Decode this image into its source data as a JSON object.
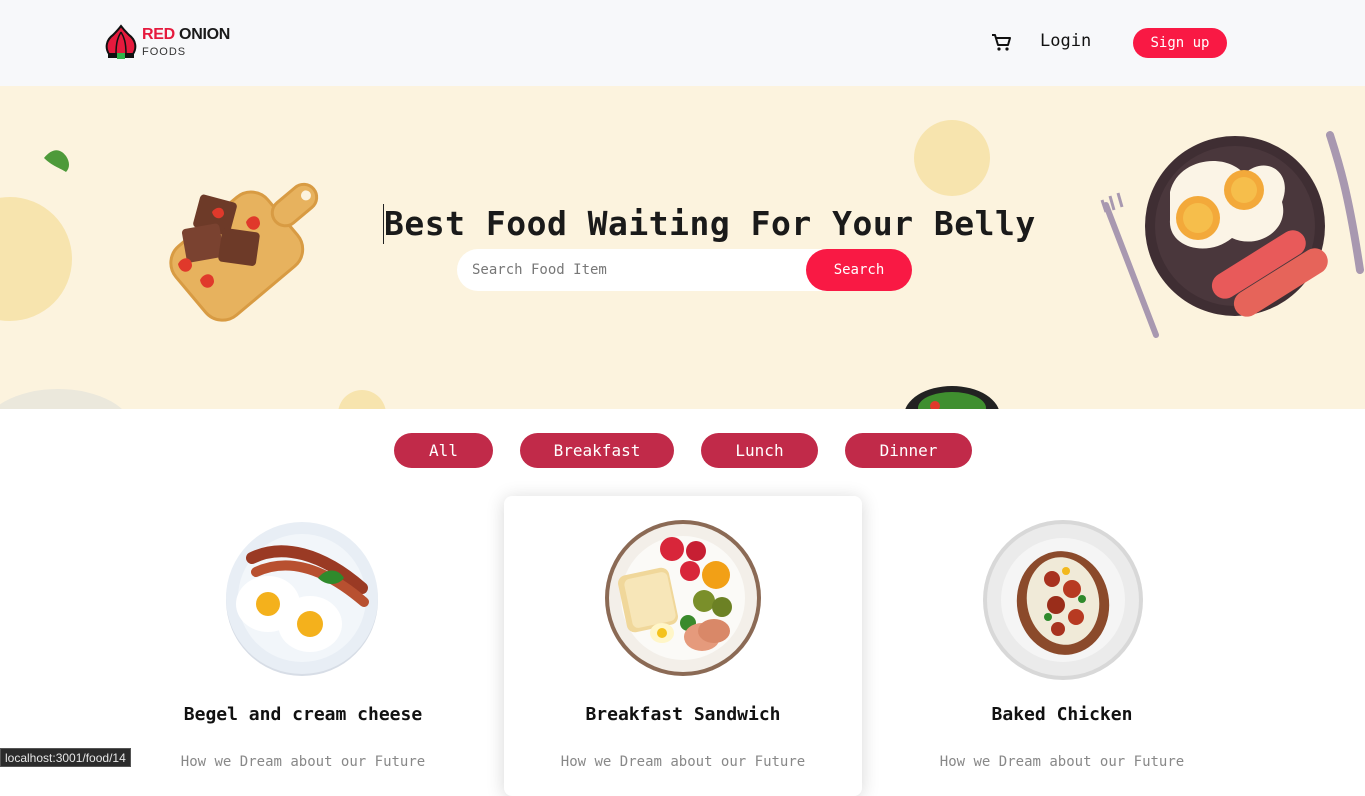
{
  "brand": {
    "name_red": "RED",
    "name_dark": "ONION",
    "subtitle": "FOODS",
    "accent": "#f91944"
  },
  "nav": {
    "cart_icon": "cart-icon",
    "login_label": "Login",
    "signup_label": "Sign up"
  },
  "hero": {
    "title": "Best Food Waiting For Your Belly",
    "search_placeholder": "Search Food Item",
    "search_label": "Search",
    "background": "#fcf3de"
  },
  "tabs": [
    {
      "label": "All"
    },
    {
      "label": "Breakfast"
    },
    {
      "label": "Lunch"
    },
    {
      "label": "Dinner"
    }
  ],
  "foods": [
    {
      "name": "Begel and cream cheese",
      "desc": "How we Dream about our Future"
    },
    {
      "name": "Breakfast Sandwich",
      "desc": "How we Dream about our Future"
    },
    {
      "name": "Baked Chicken",
      "desc": "How we Dream about our Future"
    }
  ],
  "status_bar": {
    "url": "localhost:3001/food/14"
  }
}
